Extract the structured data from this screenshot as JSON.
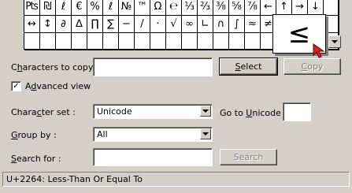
{
  "grid": {
    "rows": [
      [
        "₧",
        "₪",
        "ℓ",
        "€",
        "%",
        "ℓ",
        "№",
        "™",
        "Ω",
        "℮",
        "⅓",
        "⅔",
        "⅜",
        "⅝",
        "⅞",
        "←",
        "↑",
        "→",
        "↓",
        ""
      ],
      [
        "↔",
        "↕",
        "∂",
        "∆",
        "∏",
        "∑",
        "−",
        "/",
        "·",
        "√",
        "∞",
        "∟",
        "∩",
        "∫",
        "≈",
        "≠",
        "≡",
        "≤",
        "≥",
        ""
      ],
      [
        "",
        "",
        "",
        "",
        "",
        "",
        "",
        "",
        "",
        "",
        "",
        "",
        "",
        "",
        "",
        "",
        "",
        "",
        "",
        ""
      ]
    ]
  },
  "enlarged_char": "≤",
  "characters_to_copy": {
    "label": "Characters to copy :",
    "value": ""
  },
  "select_button": "Select",
  "copy_button": "Copy",
  "advanced_view": {
    "label": "Advanced view",
    "checked": true,
    "mark": "✓"
  },
  "character_set": {
    "label": "Character set :",
    "value": "Unicode"
  },
  "go_to_unicode": {
    "label": "Go to Unicode :",
    "value": ""
  },
  "group_by": {
    "label": "Group by :",
    "value": "All"
  },
  "search_for": {
    "label": "Search for :",
    "value": ""
  },
  "search_button": "Search",
  "status": "U+2264: Less-Than Or Equal To"
}
